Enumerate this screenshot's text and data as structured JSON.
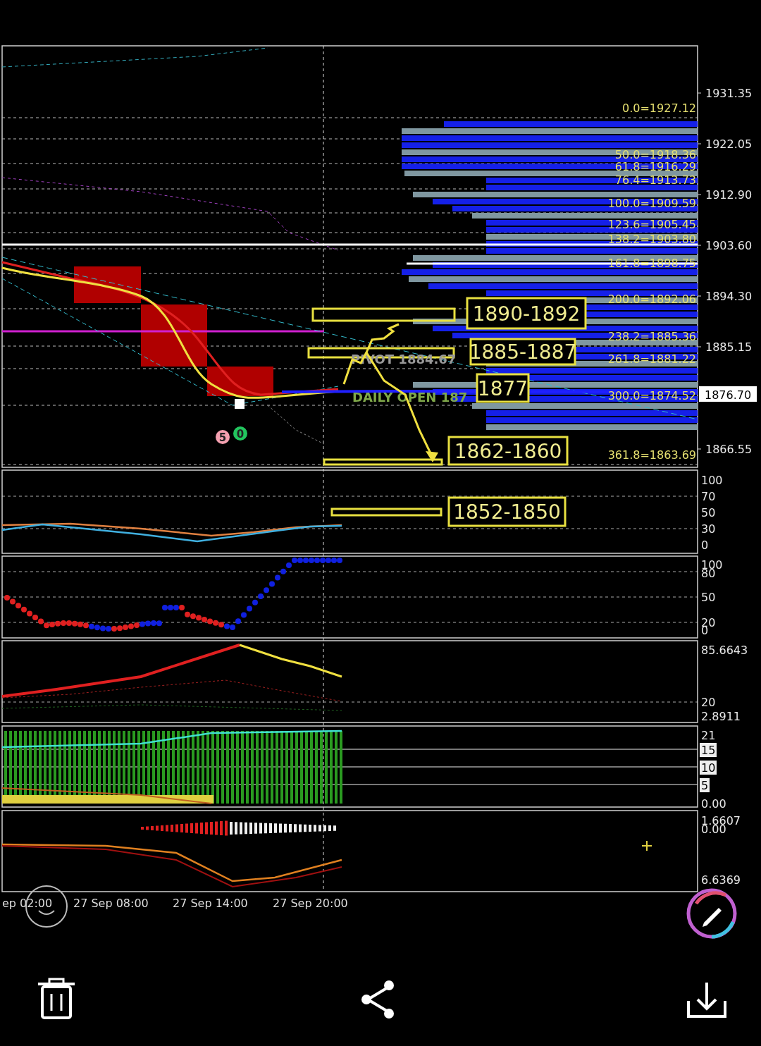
{
  "price_axis": [
    "1931.35",
    "1922.05",
    "1912.90",
    "1903.60",
    "1894.30",
    "1885.15",
    "1866.55"
  ],
  "current_price": "1876.70",
  "fib_levels": [
    "0.0=1927.12",
    "50.0=1918.36",
    "61.8=1916.29",
    "76.4=1913.73",
    "100.0=1909.59",
    "123.6=1905.45",
    "138.2=1903.80",
    "161.8=1898.75",
    "200.0=1892.06",
    "238.2=1885.36",
    "261.8=1881.22",
    "300.0=1874.52",
    "361.8=1863.69"
  ],
  "zones": [
    {
      "label": "1890-1892"
    },
    {
      "label": "1885-1887"
    },
    {
      "label": "1877"
    },
    {
      "label": "1862-1860"
    },
    {
      "label": "1852-1850"
    }
  ],
  "chart_labels": [
    {
      "text": "PIVOT 1884.67",
      "color": "#9a9a9a"
    },
    {
      "text": "DAILY OPEN 187",
      "color": "#7fa84a"
    }
  ],
  "signal_markers": [
    {
      "label": "5",
      "color": "#f4a0b0"
    },
    {
      "label": "0",
      "color": "#22c55e"
    }
  ],
  "indicator_panels": [
    {
      "axis": [
        {
          "label": "100",
          "boxed": false
        },
        {
          "label": "70",
          "boxed": false
        },
        {
          "label": "50",
          "boxed": false
        },
        {
          "label": "30",
          "boxed": false
        },
        {
          "label": "0",
          "boxed": false
        }
      ]
    },
    {
      "axis": [
        {
          "label": "100",
          "boxed": false
        },
        {
          "label": "80",
          "boxed": false
        },
        {
          "label": "50",
          "boxed": false
        },
        {
          "label": "20",
          "boxed": false
        },
        {
          "label": "0",
          "boxed": false
        }
      ]
    },
    {
      "axis": [
        {
          "label": "85.6643",
          "boxed": false
        },
        {
          "label": "20",
          "boxed": false
        },
        {
          "label": "2.8911",
          "boxed": false
        }
      ]
    },
    {
      "axis": [
        {
          "label": "21",
          "boxed": false
        },
        {
          "label": "15",
          "boxed": true
        },
        {
          "label": "10",
          "boxed": true
        },
        {
          "label": "5",
          "boxed": true
        },
        {
          "label": "0.00",
          "boxed": false
        }
      ]
    },
    {
      "axis": [
        {
          "label": "1.6607",
          "boxed": false
        },
        {
          "label": "0.00",
          "boxed": false
        },
        {
          "label": "6.6369",
          "boxed": false
        }
      ]
    }
  ],
  "time_axis": [
    "ep 02:00",
    "27 Sep 08:00",
    "27 Sep 14:00",
    "27 Sep 20:00"
  ]
}
